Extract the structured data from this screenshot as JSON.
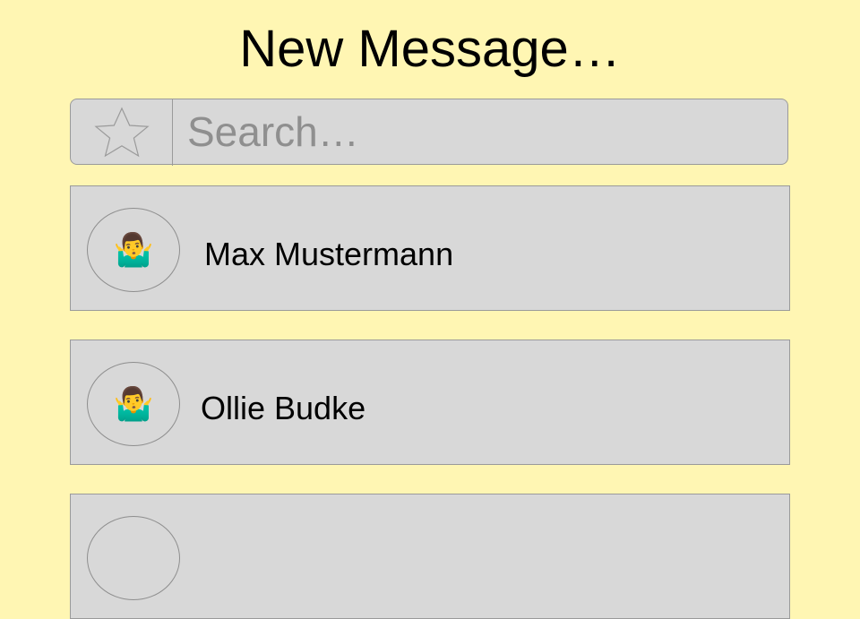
{
  "header": {
    "title": "New Message…"
  },
  "search": {
    "placeholder": "Search…",
    "value": "",
    "favorites_icon": "star-icon"
  },
  "contacts": [
    {
      "name": "Max Mustermann",
      "avatar": "🤷‍♂️",
      "avatar_icon": "person-shrugging-icon"
    },
    {
      "name": "Ollie Budke",
      "avatar": "🤷‍♂️",
      "avatar_icon": "person-shrugging-icon"
    },
    {
      "name": "",
      "avatar": "",
      "avatar_icon": "avatar-placeholder"
    }
  ],
  "colors": {
    "background": "#fff6b3",
    "row_background": "#d8d8d8",
    "border": "#9a9a9a",
    "placeholder_text": "#8f8f8f"
  }
}
